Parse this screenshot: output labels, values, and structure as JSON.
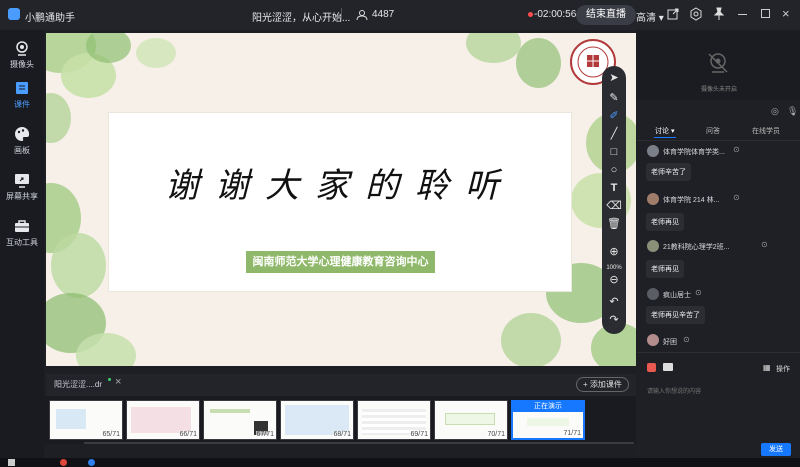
{
  "app": {
    "title": "小鹏通助手",
    "session_title": "阳光涩涩，从心开始...",
    "viewer_count": "4487",
    "timer": "-02:00:56",
    "end_live_label": "结束直播",
    "quality_label": "高清"
  },
  "sidebar": {
    "items": [
      {
        "label": "摄像头",
        "icon": "camera-icon"
      },
      {
        "label": "课件",
        "icon": "courseware-icon"
      },
      {
        "label": "画板",
        "icon": "palette-icon"
      },
      {
        "label": "屏幕共享",
        "icon": "screen-share-icon"
      },
      {
        "label": "互动工具",
        "icon": "toolbox-icon"
      }
    ]
  },
  "slide": {
    "headline": "谢谢大家的聆听",
    "center_name": "闽南师范大学心理健康教育咨询中心"
  },
  "toolbar": {
    "zoom_label": "100%"
  },
  "file_bar": {
    "file_tab": "阳光涩涩....dr",
    "add_courseware_label": "+ 添加课件"
  },
  "thumbnails": [
    {
      "num": "65/71"
    },
    {
      "num": "66/71"
    },
    {
      "num": "67/71"
    },
    {
      "num": "68/71"
    },
    {
      "num": "69/71"
    },
    {
      "num": "70/71"
    },
    {
      "num": "71/71",
      "status": "正在演示"
    }
  ],
  "right_panel": {
    "camera_status": "摄像头未开启",
    "tabs": [
      "讨论",
      "问答",
      "在线学员"
    ],
    "messages": [
      {
        "name": "体育学院体育学类...",
        "text": "老师辛苦了"
      },
      {
        "name": "体育学院 214 林...",
        "text": "老师再见"
      },
      {
        "name": "21教科院心理学2班...",
        "text": "老师再见"
      },
      {
        "name": "疯山居士",
        "text": "老师再见辛苦了"
      },
      {
        "name": "好困",
        "text": ""
      }
    ],
    "operate_label": "操作",
    "input_placeholder": "请输入你想说的内容",
    "send_label": "发送"
  },
  "colors": {
    "accent": "#1677ff",
    "timer_red": "#ff4d4f",
    "slide_green": "#8fb86a"
  }
}
